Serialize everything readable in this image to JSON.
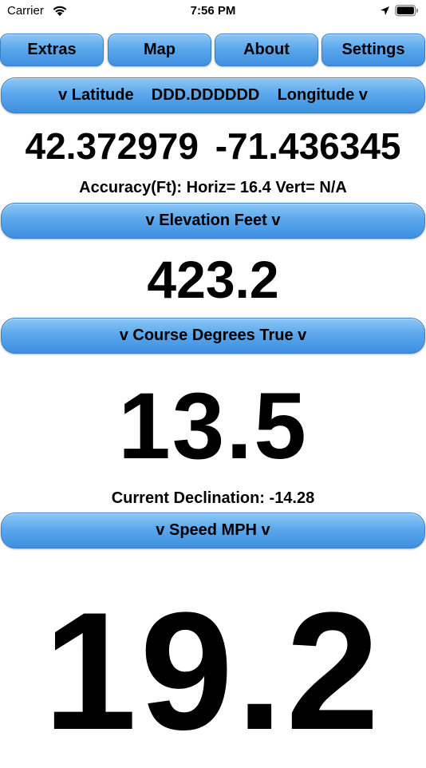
{
  "status": {
    "carrier": "Carrier",
    "time": "7:56 PM"
  },
  "tabs": [
    "Extras",
    "Map",
    "About",
    "Settings"
  ],
  "latlon": {
    "header": "v Latitude    DDD.DDDDDD    Longitude v",
    "latitude": "42.372979",
    "longitude": "-71.436345",
    "accuracy": "Accuracy(Ft): Horiz= 16.4 Vert= N/A"
  },
  "elevation": {
    "header": "v Elevation Feet v",
    "value": "423.2"
  },
  "course": {
    "header": "v Course Degrees True v",
    "value": "13.5",
    "declination": "Current Declination: -14.28"
  },
  "speed": {
    "header": "v Speed MPH v",
    "value": "19.2"
  },
  "colors": {
    "button_top": "#8cc7f5",
    "button_bottom": "#3e8fe0",
    "button_border": "#3a7fc4"
  }
}
